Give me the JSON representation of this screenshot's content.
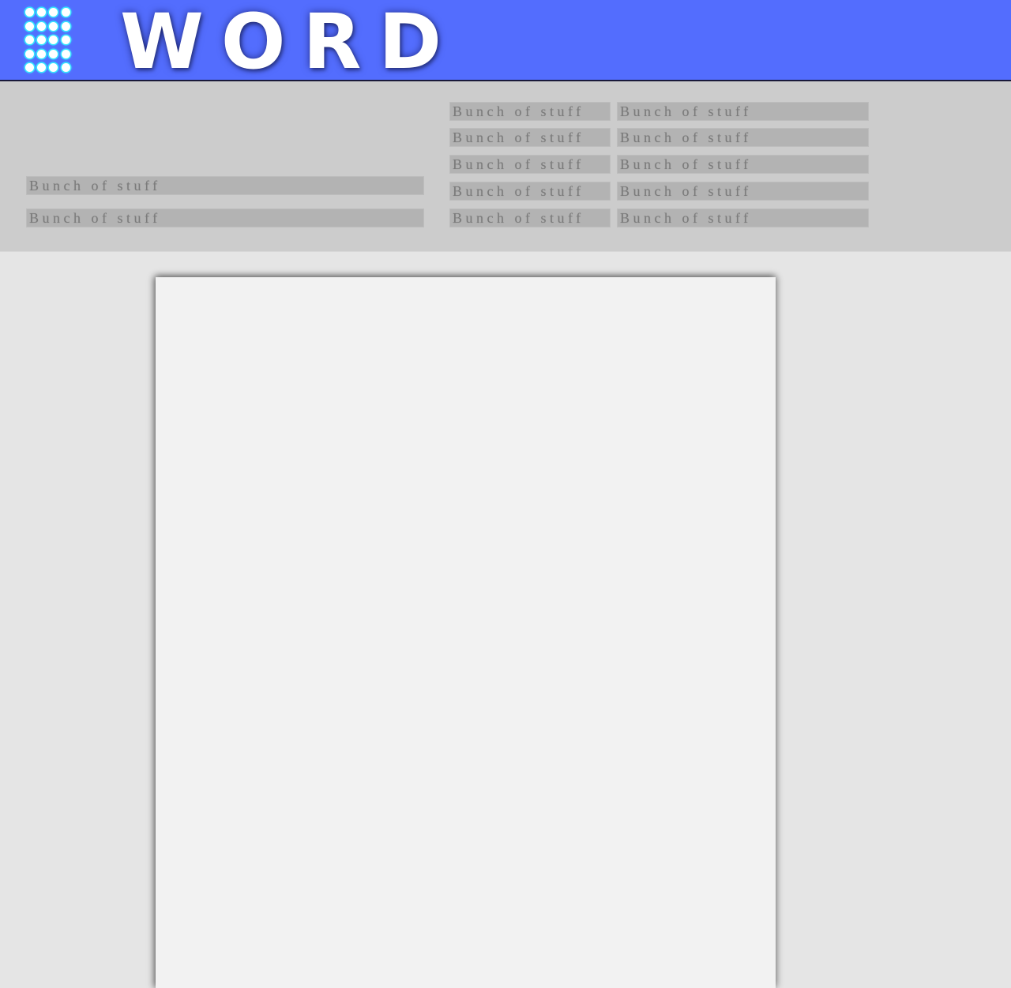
{
  "app": {
    "title": "WORD",
    "accent_color": "#536dfe",
    "launcher_icon": "dot-grid-icon"
  },
  "ribbon": {
    "left_items": [
      {
        "label": "Bunch of stuff"
      },
      {
        "label": "Bunch of stuff"
      }
    ],
    "grid_items": [
      {
        "label": "Bunch of stuff"
      },
      {
        "label": "Bunch of stuff"
      },
      {
        "label": "Bunch of stuff"
      },
      {
        "label": "Bunch of stuff"
      },
      {
        "label": "Bunch of stuff"
      },
      {
        "label": "Bunch of stuff"
      },
      {
        "label": "Bunch of stuff"
      },
      {
        "label": "Bunch of stuff"
      },
      {
        "label": "Bunch of stuff"
      },
      {
        "label": "Bunch of stuff"
      }
    ]
  },
  "document": {
    "content": ""
  }
}
